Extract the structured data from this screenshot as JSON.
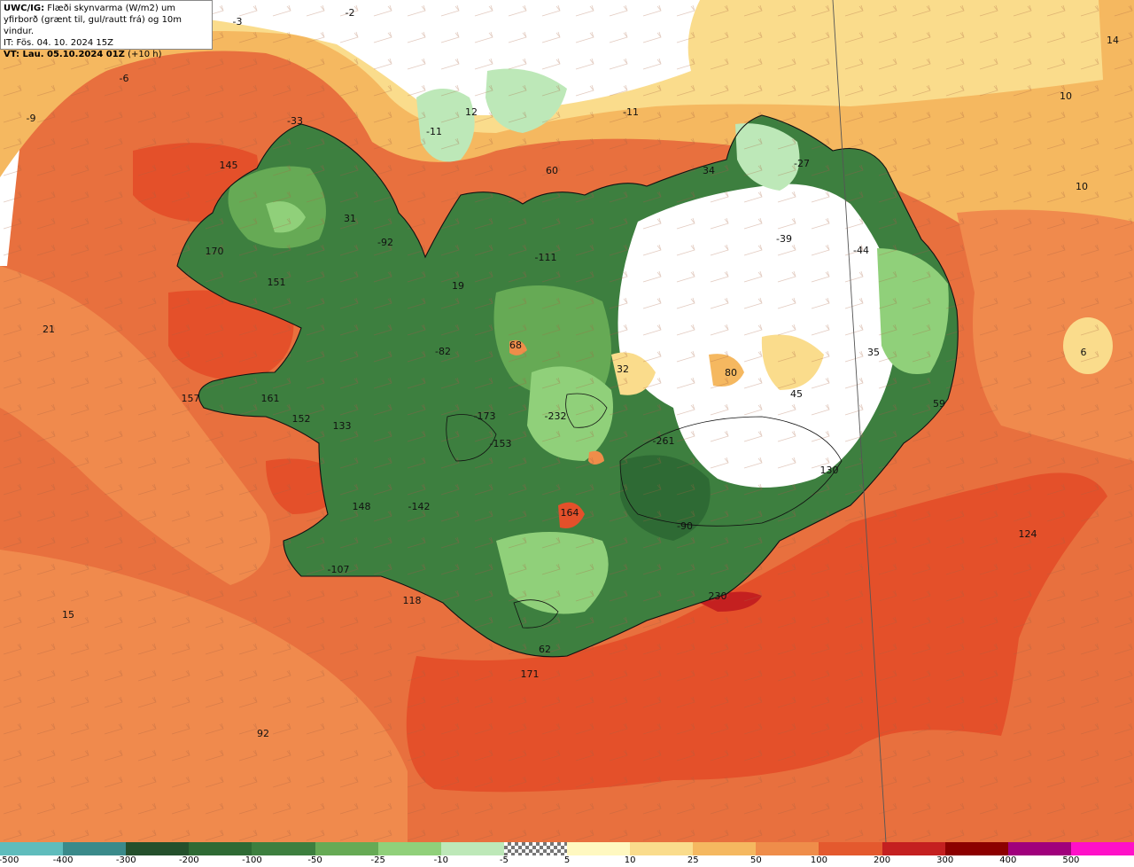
{
  "header": {
    "line1_bold": "UWC/IG:",
    "line1_rest": " Flæði skynvarma (W/m2) um",
    "line2": "yfirborð (grænt til, gul/rautt frá) og 10m vindur.",
    "line3": "IT: Fös. 04. 10. 2024 15Z",
    "line4_bold": "VT: Lau. 05.10.2024 01Z",
    "line4_rest": " (+10 h)"
  },
  "legend": {
    "ticks": [
      "-500",
      "-400",
      "-300",
      "-200",
      "-100",
      "-50",
      "-25",
      "-10",
      "-5",
      "5",
      "10",
      "25",
      "50",
      "100",
      "200",
      "300",
      "400",
      "500"
    ],
    "colors": [
      "#5fbcbc",
      "#3a8a8a",
      "#24502c",
      "#2e6a34",
      "#3d7f3f",
      "#66aa55",
      "#90d07a",
      "#bde8b8",
      "checker",
      "#fff8c0",
      "#fadc8c",
      "#f5b860",
      "#ef8d4a",
      "#e4592e",
      "#c42020",
      "#8c0000",
      "#a0007c",
      "#ff10c8"
    ]
  },
  "map": {
    "colors": {
      "sea_base": "#e8703e",
      "sea_light": "#f08a4d",
      "sea_pale": "#f5b860",
      "sea_yellow": "#fadc8c",
      "sea_hot": "#e4502a",
      "sea_darkhot": "#c42020",
      "white": "#ffffff",
      "green_pale": "#bde8b8",
      "green_light": "#90d07a",
      "green_mid": "#66aa55",
      "green_dark": "#3d7f3f",
      "green_darker": "#2e6a34"
    },
    "values": [
      {
        "text": "-2"
      },
      {
        "text": "-3"
      },
      {
        "text": "-6"
      },
      {
        "text": "-9"
      },
      {
        "text": "-33"
      },
      {
        "text": "145"
      },
      {
        "text": "31"
      },
      {
        "text": "-92"
      },
      {
        "text": "170"
      },
      {
        "text": "151"
      },
      {
        "text": "21"
      },
      {
        "text": "157"
      },
      {
        "text": "161"
      },
      {
        "text": "152"
      },
      {
        "text": "133"
      },
      {
        "text": "148"
      },
      {
        "text": "-142"
      },
      {
        "text": "-107"
      },
      {
        "text": "118"
      },
      {
        "text": "15"
      },
      {
        "text": "92"
      },
      {
        "text": "171"
      },
      {
        "text": "62"
      },
      {
        "text": "12"
      },
      {
        "text": "-11"
      },
      {
        "text": "-11"
      },
      {
        "text": "60"
      },
      {
        "text": "34"
      },
      {
        "text": "-27"
      },
      {
        "text": "14"
      },
      {
        "text": "10"
      },
      {
        "text": "10"
      },
      {
        "text": "-39"
      },
      {
        "text": "-44"
      },
      {
        "text": "-111"
      },
      {
        "text": "19"
      },
      {
        "text": "-82"
      },
      {
        "text": "68"
      },
      {
        "text": "32"
      },
      {
        "text": "80"
      },
      {
        "text": "45"
      },
      {
        "text": "35"
      },
      {
        "text": "59"
      },
      {
        "text": "6"
      },
      {
        "text": "-173"
      },
      {
        "text": "-232"
      },
      {
        "text": "-153"
      },
      {
        "text": "-261"
      },
      {
        "text": "130"
      },
      {
        "text": "164"
      },
      {
        "text": "-90"
      },
      {
        "text": "124"
      },
      {
        "text": "230"
      }
    ]
  }
}
